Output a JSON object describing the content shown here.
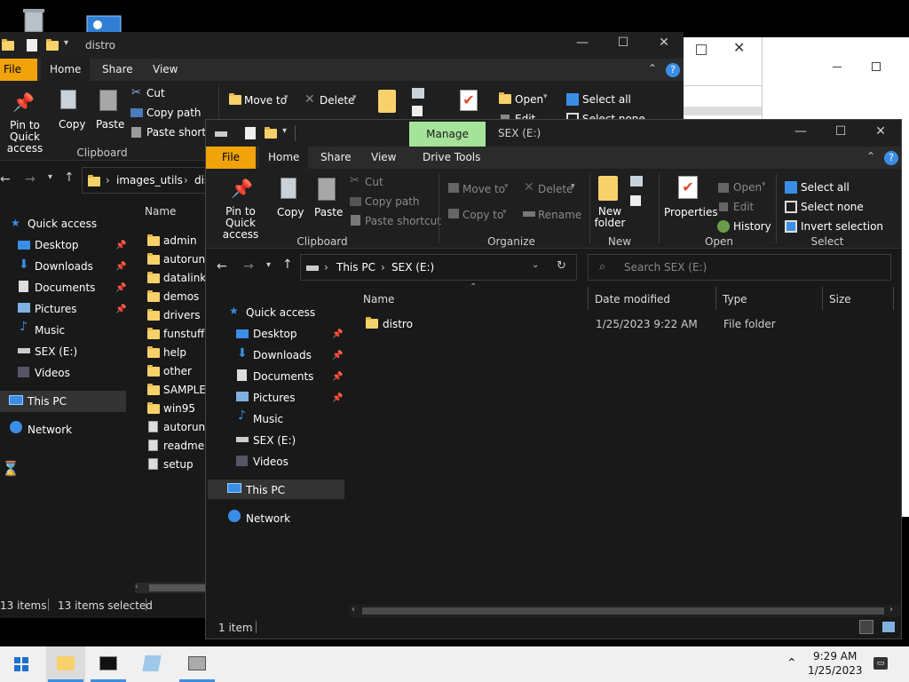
{
  "back_window": {
    "title": "distro",
    "tabs": {
      "file": "File",
      "home": "Home",
      "share": "Share",
      "view": "View"
    },
    "ribbon": {
      "pin": "Pin to Quick access",
      "copy": "Copy",
      "paste": "Paste",
      "cut": "Cut",
      "copy_path": "Copy path",
      "paste_shortcut": "Paste shortcut",
      "clipboard": "Clipboard",
      "move_to": "Move to",
      "delete": "Delete",
      "open": "Open",
      "edit": "Edit",
      "select_all": "Select all",
      "select_none": "Select none"
    },
    "breadcrumb": {
      "item1": "images_utils",
      "item2": "dis"
    },
    "nav": {
      "quick_access": "Quick access",
      "desktop": "Desktop",
      "downloads": "Downloads",
      "documents": "Documents",
      "pictures": "Pictures",
      "music": "Music",
      "sex_e": "SEX (E:)",
      "videos": "Videos",
      "this_pc": "This PC",
      "network": "Network"
    },
    "column_name": "Name",
    "files": [
      "admin",
      "autorun",
      "datalink",
      "demos",
      "drivers",
      "funstuff",
      "help",
      "other",
      "SAMPLER",
      "win95",
      "autorun",
      "readme",
      "setup"
    ],
    "status": {
      "items": "13 items",
      "selected": "13 items selected"
    }
  },
  "front_window": {
    "title": "SEX (E:)",
    "manage_tab": "Manage",
    "tabs": {
      "file": "File",
      "home": "Home",
      "share": "Share",
      "view": "View",
      "drive_tools": "Drive Tools"
    },
    "ribbon": {
      "pin": "Pin to Quick access",
      "copy": "Copy",
      "paste": "Paste",
      "cut": "Cut",
      "copy_path": "Copy path",
      "paste_shortcut": "Paste shortcut",
      "clipboard": "Clipboard",
      "move_to": "Move to",
      "copy_to": "Copy to",
      "delete": "Delete",
      "rename": "Rename",
      "organize": "Organize",
      "new_folder": "New folder",
      "new": "New",
      "properties": "Properties",
      "open": "Open",
      "edit": "Edit",
      "history": "History",
      "open_group": "Open",
      "select_all": "Select all",
      "select_none": "Select none",
      "invert_selection": "Invert selection",
      "select_group": "Select"
    },
    "address": {
      "this_pc": "This PC",
      "drive": "SEX (E:)"
    },
    "search_placeholder": "Search SEX (E:)",
    "nav": {
      "quick_access": "Quick access",
      "desktop": "Desktop",
      "downloads": "Downloads",
      "documents": "Documents",
      "pictures": "Pictures",
      "music": "Music",
      "sex_e": "SEX (E:)",
      "videos": "Videos",
      "this_pc": "This PC",
      "network": "Network"
    },
    "columns": {
      "name": "Name",
      "date": "Date modified",
      "type": "Type",
      "size": "Size"
    },
    "rows": [
      {
        "name": "distro",
        "date": "1/25/2023 9:22 AM",
        "type": "File folder",
        "size": ""
      }
    ],
    "status": {
      "items": "1 item"
    }
  },
  "taskbar": {
    "time": "9:29 AM",
    "date": "1/25/2023"
  },
  "colors": {
    "file_tab": "#f0a30a",
    "manage_tab": "#a6e39a",
    "accent": "#3a8ee6",
    "folder": "#f7d26a"
  }
}
